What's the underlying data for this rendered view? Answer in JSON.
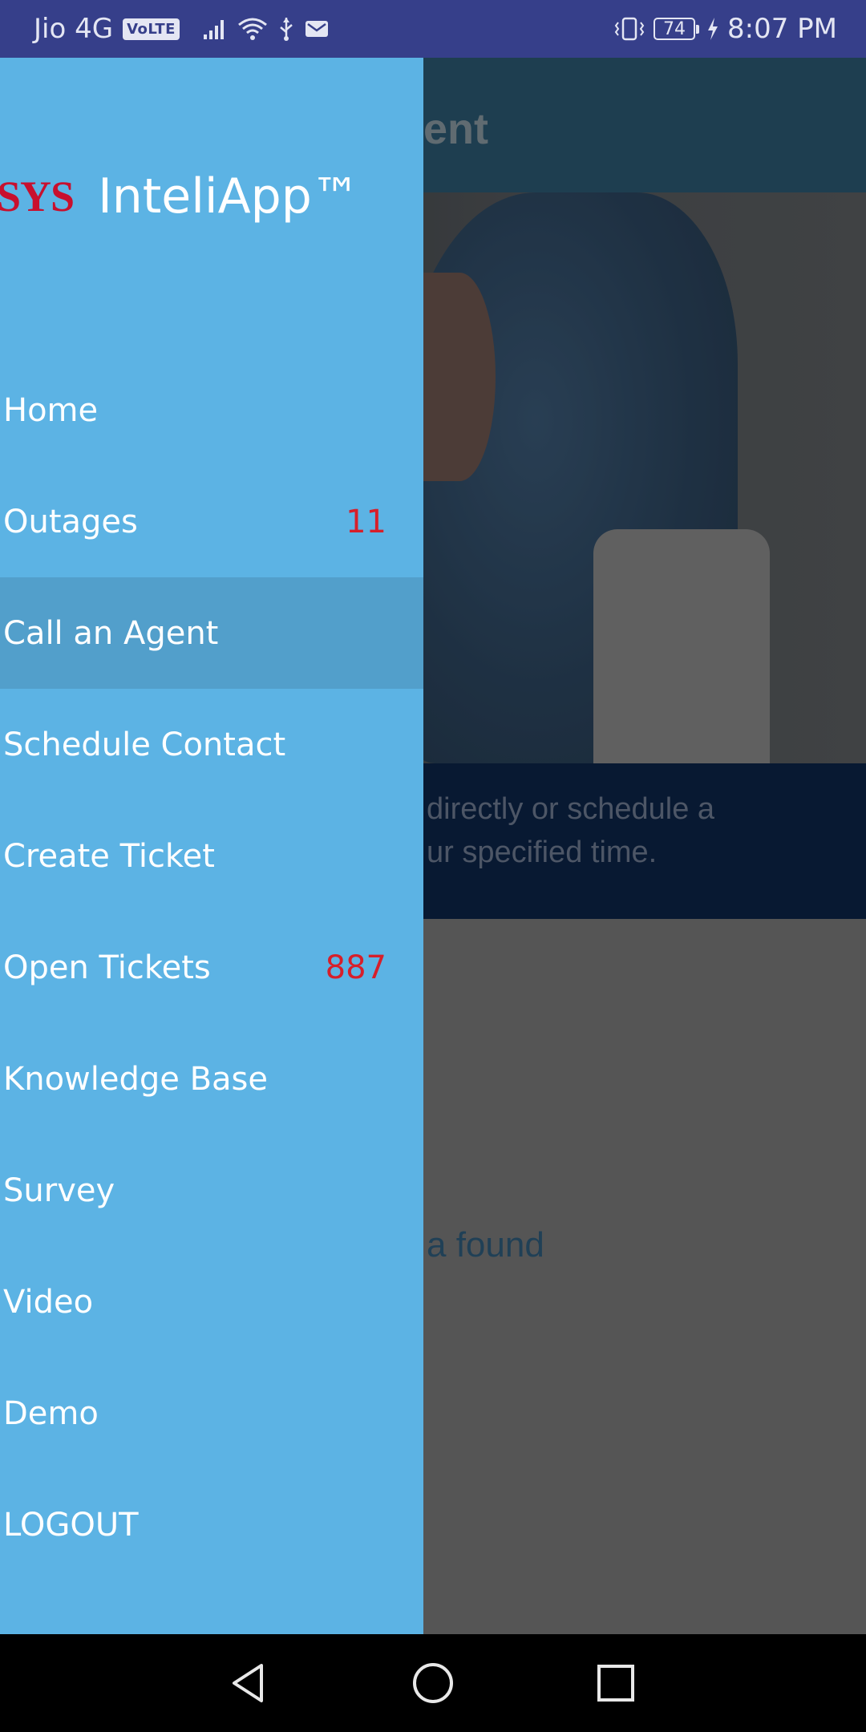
{
  "status_bar": {
    "carrier": "Jio 4G",
    "volte": "VoLTE",
    "battery": "74",
    "time": "8:07 PM",
    "icons": [
      "signal-icon",
      "wifi-icon",
      "usb-icon",
      "mail-icon",
      "vibrate-icon",
      "charging-icon"
    ]
  },
  "background_page": {
    "title_fragment": "an Agent",
    "banner_line1": "directly or schedule a",
    "banner_line2": "ur specified time.",
    "empty_text": "a found"
  },
  "drawer": {
    "logo_mark": "SYS",
    "app_name": "InteliApp™",
    "items": [
      {
        "label": "Home",
        "badge": ""
      },
      {
        "label": "Outages",
        "badge": "11"
      },
      {
        "label": "Call an Agent",
        "badge": ""
      },
      {
        "label": "Schedule Contact",
        "badge": ""
      },
      {
        "label": "Create Ticket",
        "badge": ""
      },
      {
        "label": "Open Tickets",
        "badge": "887"
      },
      {
        "label": "Knowledge Base",
        "badge": ""
      },
      {
        "label": "Survey",
        "badge": ""
      },
      {
        "label": "Video",
        "badge": ""
      },
      {
        "label": "Demo",
        "badge": ""
      },
      {
        "label": "LOGOUT",
        "badge": ""
      }
    ],
    "active_index": 2
  },
  "nav_bar": {
    "icons": [
      "back-icon",
      "home-icon",
      "recents-icon"
    ]
  },
  "colors": {
    "drawer": "#5cb3e4",
    "drawer_active": "#529fcb",
    "badge": "#d61f2a",
    "status_bar": "#363f8a"
  }
}
